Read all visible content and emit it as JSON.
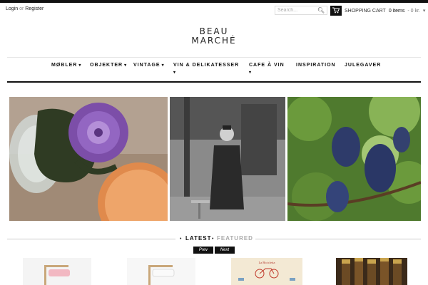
{
  "header": {
    "login": "Login",
    "or": "or",
    "register": "Register",
    "search_placeholder": "Search...",
    "cart_label": "SHOPPING CART",
    "cart_items": "0 items",
    "cart_total": "- 0 kr.",
    "cart_caret": "▾"
  },
  "logo": {
    "line1": "BEAU",
    "line2": "MARCHÉ"
  },
  "nav": {
    "items": [
      {
        "label": "MØBLER"
      },
      {
        "label": "OBJEKTER"
      },
      {
        "label": "VINTAGE"
      },
      {
        "label": "VIN & DELIKATESSER"
      },
      {
        "label": "CAFE À VIN"
      },
      {
        "label": "INSPIRATION"
      },
      {
        "label": "JULEGAVER"
      }
    ]
  },
  "tabs": {
    "latest": "LATEST",
    "featured": "FEATURED"
  },
  "pager": {
    "prev": "Prev",
    "next": "Next"
  },
  "products": {
    "poster_title": "La Bicicletta"
  },
  "colors": {
    "accent": "#111111",
    "muted": "#aaaaaa"
  }
}
